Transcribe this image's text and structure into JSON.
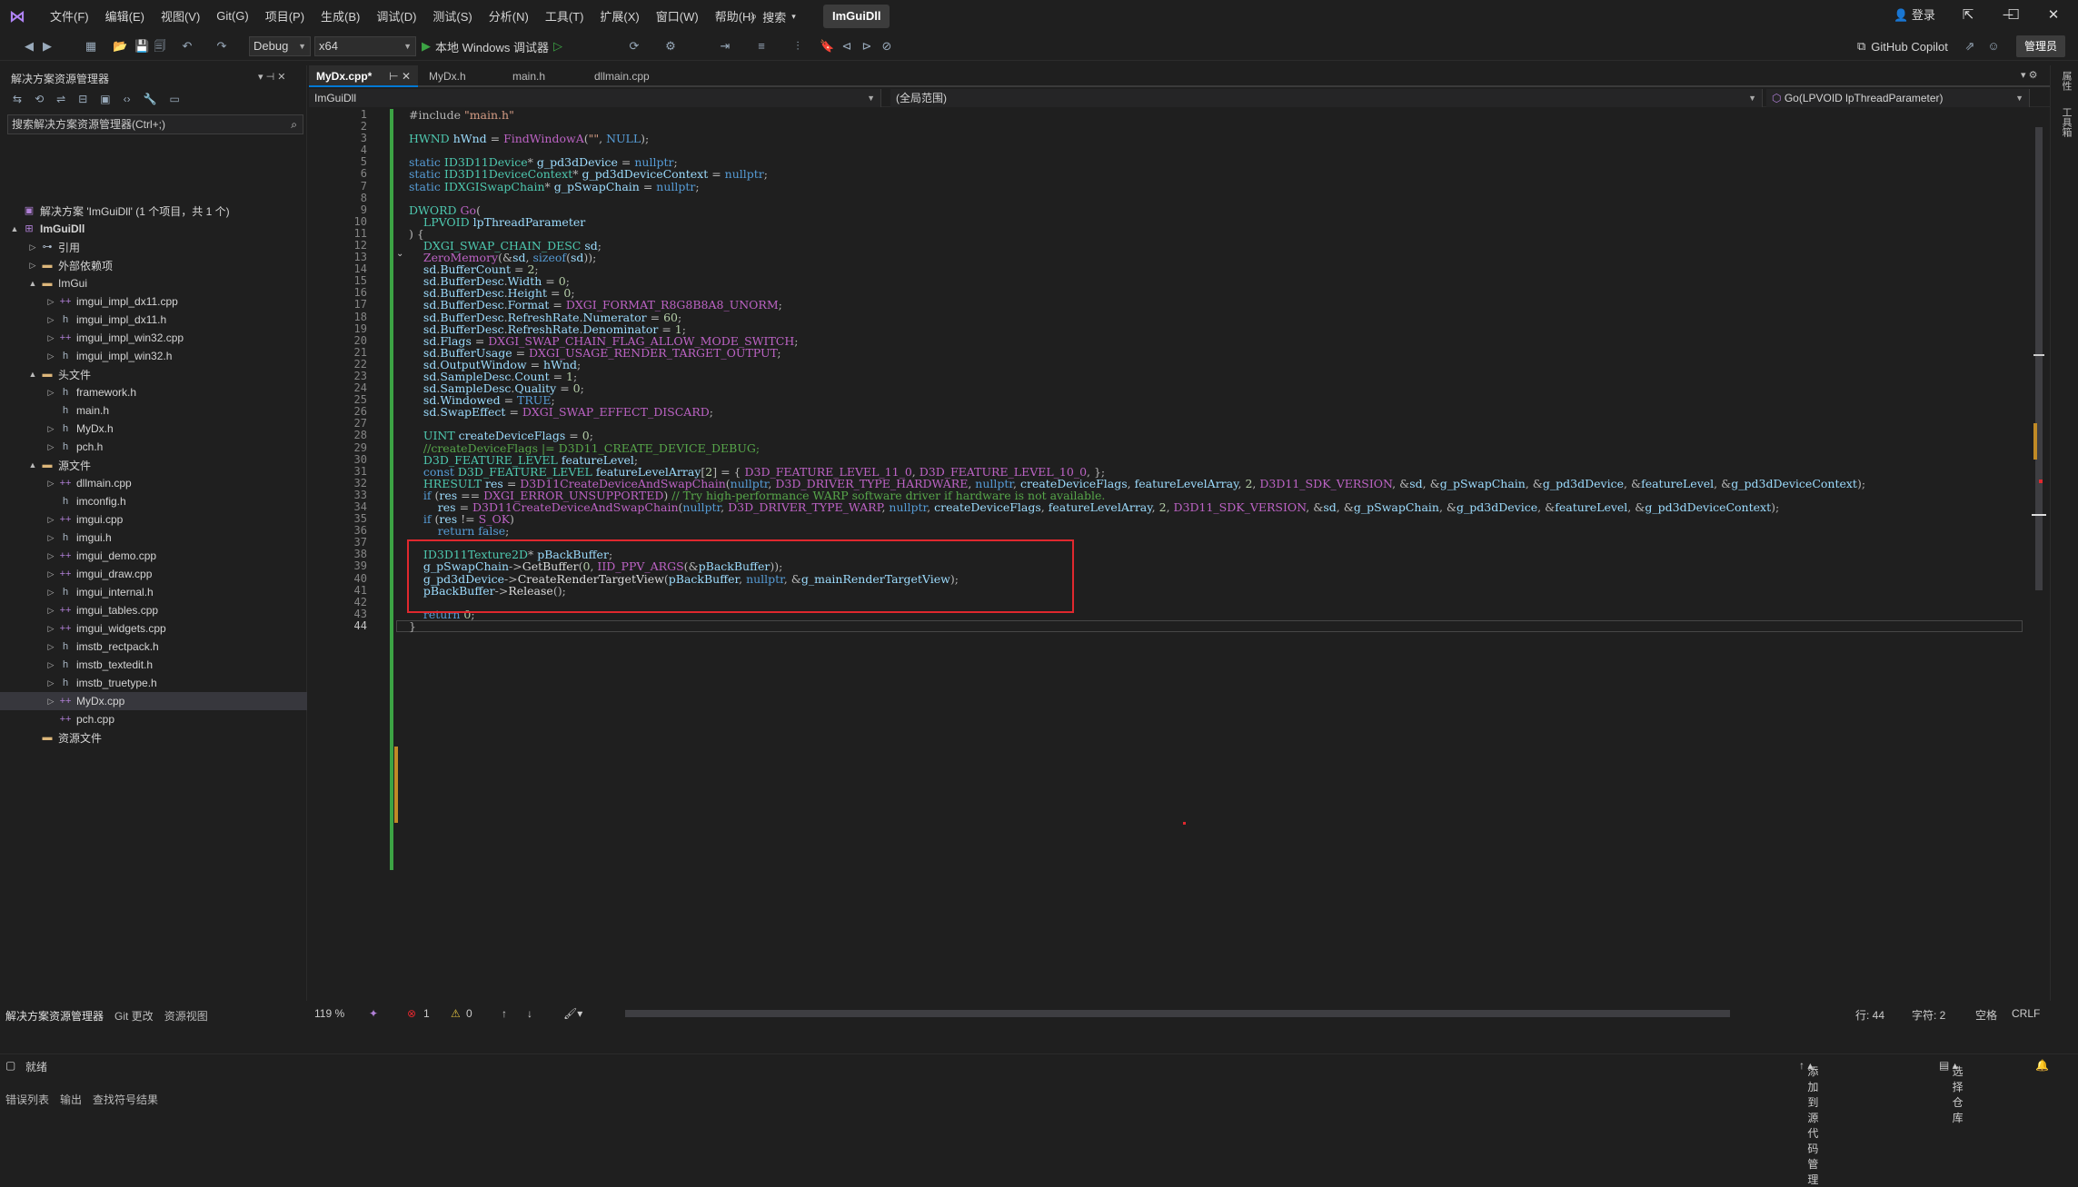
{
  "titlebar": {
    "menus": [
      "文件(F)",
      "编辑(E)",
      "视图(V)",
      "Git(G)",
      "项目(P)",
      "生成(B)",
      "调试(D)",
      "测试(S)",
      "分析(N)",
      "工具(T)",
      "扩展(X)",
      "窗口(W)",
      "帮助(H)"
    ],
    "search_label": "搜索",
    "solution_name": "ImGuiDll",
    "login_label": "登录"
  },
  "toolbar": {
    "config": "Debug",
    "platform": "x64",
    "run_label": "本地 Windows 调试器",
    "copilot_label": "GitHub Copilot",
    "admin_label": "管理员"
  },
  "solution_explorer": {
    "title": "解决方案资源管理器",
    "search_placeholder": "搜索解决方案资源管理器(Ctrl+;)",
    "items": [
      {
        "label": "解决方案 'ImGuiDll' (1 个项目，共 1 个)",
        "icon": "solution-icon",
        "level": 0,
        "twisty": ""
      },
      {
        "label": "ImGuiDll",
        "icon": "project-icon",
        "level": 0,
        "twisty": "▲",
        "bold": true
      },
      {
        "label": "引用",
        "icon": "references-icon",
        "level": 1,
        "twisty": "▷"
      },
      {
        "label": "外部依赖项",
        "icon": "folder-icon",
        "level": 1,
        "twisty": "▷"
      },
      {
        "label": "ImGui",
        "icon": "folder-icon",
        "level": 1,
        "twisty": "▲"
      },
      {
        "label": "imgui_impl_dx11.cpp",
        "icon": "cpp-file-icon",
        "level": 2,
        "twisty": "▷"
      },
      {
        "label": "imgui_impl_dx11.h",
        "icon": "header-file-icon",
        "level": 2,
        "twisty": "▷"
      },
      {
        "label": "imgui_impl_win32.cpp",
        "icon": "cpp-file-icon",
        "level": 2,
        "twisty": "▷"
      },
      {
        "label": "imgui_impl_win32.h",
        "icon": "header-file-icon",
        "level": 2,
        "twisty": "▷"
      },
      {
        "label": "头文件",
        "icon": "folder-icon",
        "level": 1,
        "twisty": "▲"
      },
      {
        "label": "framework.h",
        "icon": "header-file-icon",
        "level": 2,
        "twisty": "▷"
      },
      {
        "label": "main.h",
        "icon": "header-file-icon",
        "level": 2,
        "twisty": ""
      },
      {
        "label": "MyDx.h",
        "icon": "header-file-icon",
        "level": 2,
        "twisty": "▷"
      },
      {
        "label": "pch.h",
        "icon": "header-file-icon",
        "level": 2,
        "twisty": "▷"
      },
      {
        "label": "源文件",
        "icon": "folder-icon",
        "level": 1,
        "twisty": "▲"
      },
      {
        "label": "dllmain.cpp",
        "icon": "cpp-file-icon",
        "level": 2,
        "twisty": "▷"
      },
      {
        "label": "imconfig.h",
        "icon": "header-file-icon",
        "level": 2,
        "twisty": ""
      },
      {
        "label": "imgui.cpp",
        "icon": "cpp-file-icon",
        "level": 2,
        "twisty": "▷"
      },
      {
        "label": "imgui.h",
        "icon": "header-file-icon",
        "level": 2,
        "twisty": "▷"
      },
      {
        "label": "imgui_demo.cpp",
        "icon": "cpp-file-icon",
        "level": 2,
        "twisty": "▷"
      },
      {
        "label": "imgui_draw.cpp",
        "icon": "cpp-file-icon",
        "level": 2,
        "twisty": "▷"
      },
      {
        "label": "imgui_internal.h",
        "icon": "header-file-icon",
        "level": 2,
        "twisty": "▷"
      },
      {
        "label": "imgui_tables.cpp",
        "icon": "cpp-file-icon",
        "level": 2,
        "twisty": "▷"
      },
      {
        "label": "imgui_widgets.cpp",
        "icon": "cpp-file-icon",
        "level": 2,
        "twisty": "▷"
      },
      {
        "label": "imstb_rectpack.h",
        "icon": "header-file-icon",
        "level": 2,
        "twisty": "▷"
      },
      {
        "label": "imstb_textedit.h",
        "icon": "header-file-icon",
        "level": 2,
        "twisty": "▷"
      },
      {
        "label": "imstb_truetype.h",
        "icon": "header-file-icon",
        "level": 2,
        "twisty": "▷"
      },
      {
        "label": "MyDx.cpp",
        "icon": "cpp-file-icon",
        "level": 2,
        "twisty": "▷",
        "selected": true
      },
      {
        "label": "pch.cpp",
        "icon": "cpp-file-icon",
        "level": 2,
        "twisty": ""
      },
      {
        "label": "资源文件",
        "icon": "folder-icon",
        "level": 1,
        "twisty": ""
      }
    ],
    "bottom_tabs": [
      "解决方案资源管理器",
      "Git 更改",
      "资源视图"
    ],
    "output_tabs": [
      "错误列表",
      "输出",
      "查找符号结果"
    ]
  },
  "editor": {
    "tabs": [
      "MyDx.cpp*",
      "MyDx.h",
      "main.h",
      "dllmain.cpp"
    ],
    "nav_project": "ImGuiDll",
    "nav_scope": "(全局范围)",
    "nav_member": "Go(LPVOID lpThreadParameter)",
    "lines": [
      "#include \"main.h\"",
      "",
      "HWND hWnd = FindWindowA(\"\", NULL);",
      "",
      "static ID3D11Device* g_pd3dDevice = nullptr;",
      "static ID3D11DeviceContext* g_pd3dDeviceContext = nullptr;",
      "static IDXGISwapChain* g_pSwapChain = nullptr;",
      "",
      "DWORD Go(",
      "    LPVOID lpThreadParameter",
      ") {",
      "    DXGI_SWAP_CHAIN_DESC sd;",
      "    ZeroMemory(&sd, sizeof(sd));",
      "    sd.BufferCount = 2;",
      "    sd.BufferDesc.Width = 0;",
      "    sd.BufferDesc.Height = 0;",
      "    sd.BufferDesc.Format = DXGI_FORMAT_R8G8B8A8_UNORM;",
      "    sd.BufferDesc.RefreshRate.Numerator = 60;",
      "    sd.BufferDesc.RefreshRate.Denominator = 1;",
      "    sd.Flags = DXGI_SWAP_CHAIN_FLAG_ALLOW_MODE_SWITCH;",
      "    sd.BufferUsage = DXGI_USAGE_RENDER_TARGET_OUTPUT;",
      "    sd.OutputWindow = hWnd;",
      "    sd.SampleDesc.Count = 1;",
      "    sd.SampleDesc.Quality = 0;",
      "    sd.Windowed = TRUE;",
      "    sd.SwapEffect = DXGI_SWAP_EFFECT_DISCARD;",
      "",
      "    UINT createDeviceFlags = 0;",
      "    //createDeviceFlags |= D3D11_CREATE_DEVICE_DEBUG;",
      "    D3D_FEATURE_LEVEL featureLevel;",
      "    const D3D_FEATURE_LEVEL featureLevelArray[2] = { D3D_FEATURE_LEVEL_11_0, D3D_FEATURE_LEVEL_10_0, };",
      "    HRESULT res = D3D11CreateDeviceAndSwapChain(nullptr, D3D_DRIVER_TYPE_HARDWARE, nullptr, createDeviceFlags, featureLevelArray, 2, D3D11_SDK_VERSION, &sd, &g_pSwapChain, &g_pd3dDevice, &featureLevel, &g_pd3dDeviceContext);",
      "    if (res == DXGI_ERROR_UNSUPPORTED) // Try high-performance WARP software driver if hardware is not available.",
      "        res = D3D11CreateDeviceAndSwapChain(nullptr, D3D_DRIVER_TYPE_WARP, nullptr, createDeviceFlags, featureLevelArray, 2, D3D11_SDK_VERSION, &sd, &g_pSwapChain, &g_pd3dDevice, &featureLevel, &g_pd3dDeviceContext);",
      "    if (res != S_OK)",
      "        return false;",
      "",
      "    ID3D11Texture2D* pBackBuffer;",
      "    g_pSwapChain->GetBuffer(0, IID_PPV_ARGS(&pBackBuffer));",
      "    g_pd3dDevice->CreateRenderTargetView(pBackBuffer, nullptr, &g_mainRenderTargetView);",
      "    pBackBuffer->Release();",
      "",
      "    return 0;",
      "}"
    ],
    "current_line": 44
  },
  "editor_status": {
    "zoom": "119 %",
    "errors": "1",
    "warnings": "0",
    "line": "行: 44",
    "char": "字符: 2",
    "indent": "空格",
    "eol": "CRLF"
  },
  "statusbar": {
    "ready": "就绪",
    "add_source": "添加到源代码管理",
    "select_repo": "选择仓库"
  },
  "right_rail": [
    "属性",
    "工具箱"
  ]
}
